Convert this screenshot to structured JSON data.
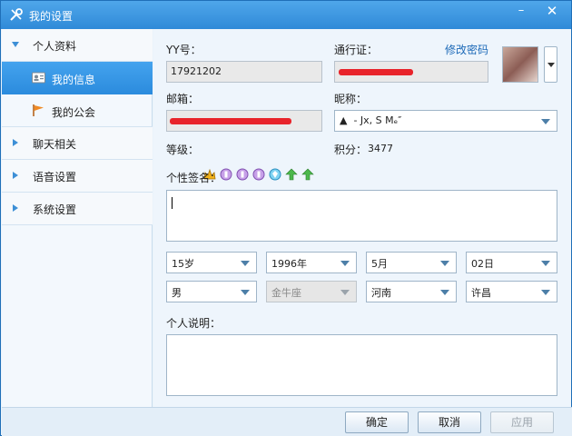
{
  "window": {
    "title": "我的设置",
    "minimize_symbol": "–",
    "close_symbol": "✕",
    "accent": "#2f8ad8",
    "icon": "tools-icon"
  },
  "sidebar": {
    "groups": [
      {
        "label": "个人资料",
        "expanded": true
      },
      {
        "label": "聊天相关",
        "expanded": false
      },
      {
        "label": "语音设置",
        "expanded": false
      },
      {
        "label": "系统设置",
        "expanded": false
      }
    ],
    "items": [
      {
        "label": "我的信息",
        "icon": "id-card-icon",
        "active": true
      },
      {
        "label": "我的公会",
        "icon": "flag-icon",
        "active": false
      }
    ]
  },
  "profile": {
    "yy_label": "YY号：",
    "yy_value": "17921202",
    "passport_label": "通行证：",
    "change_password": "修改密码",
    "email_label": "邮箱：",
    "nickname_label": "昵称：",
    "nickname_value": "▲   - Jx, S Mₑ″",
    "level_label": "等级：",
    "points_label": "积分：",
    "points_value": "3477",
    "signature_label": "个性签名：",
    "about_label": "个人说明：",
    "redaction_color": "#e8232a"
  },
  "details": {
    "age": "15岁",
    "year": "1996年",
    "month": "5月",
    "day": "02日",
    "gender": "男",
    "zodiac": "金牛座",
    "province": "河南",
    "city": "许昌"
  },
  "buttons": {
    "ok": "确定",
    "cancel": "取消",
    "apply": "应用"
  }
}
